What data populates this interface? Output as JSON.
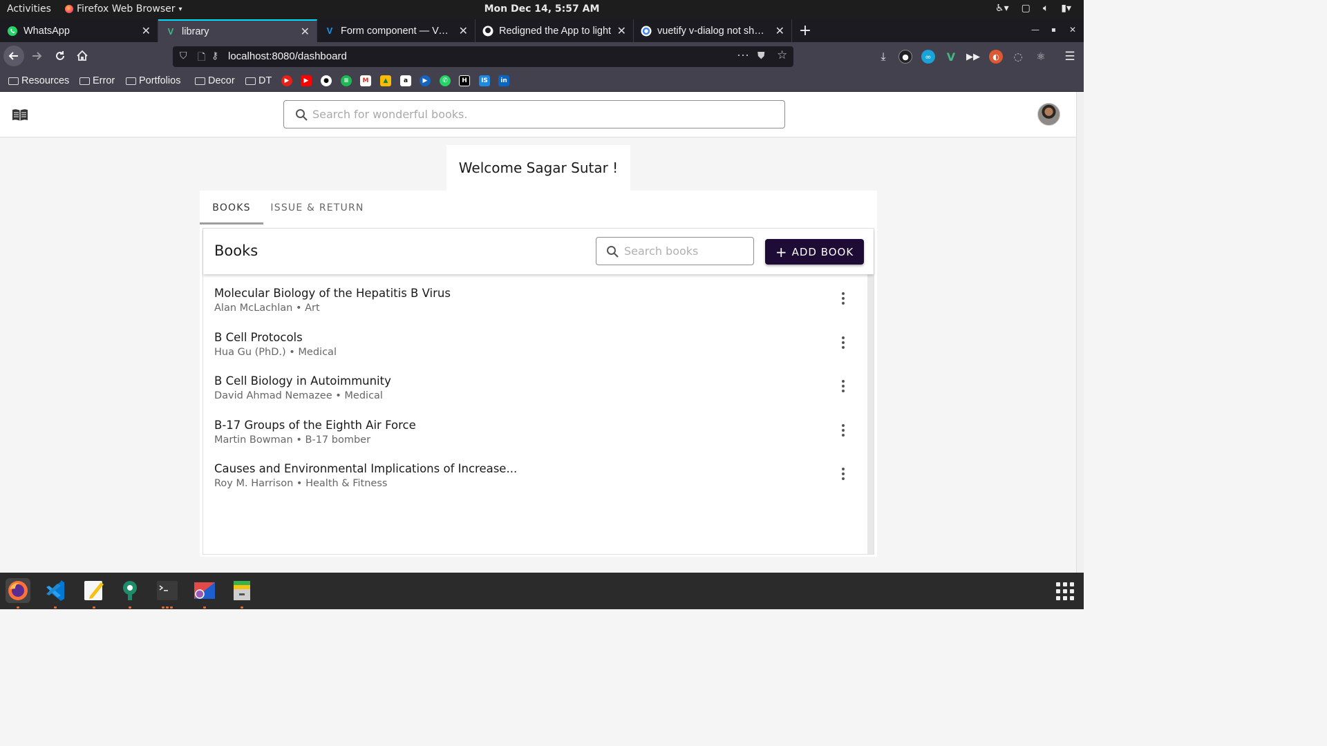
{
  "system": {
    "activities": "Activities",
    "app_name": "Firefox Web Browser",
    "clock": "Mon Dec 14,  5:57 AM"
  },
  "browser": {
    "tabs": [
      {
        "title": "WhatsApp",
        "icon": "whatsapp-icon"
      },
      {
        "title": "library",
        "icon": "vue-icon"
      },
      {
        "title": "Form component — Vuetify",
        "icon": "vuetify-icon"
      },
      {
        "title": "Redigned the App to light",
        "icon": "github-icon"
      },
      {
        "title": "vuetify v-dialog not showing",
        "icon": "google-icon"
      }
    ],
    "url": "localhost:8080/dashboard",
    "bookmarks": [
      {
        "label": "Resources"
      },
      {
        "label": "Error"
      },
      {
        "label": "Portfolios"
      },
      {
        "label": "Decor"
      },
      {
        "label": "DT"
      }
    ]
  },
  "app": {
    "search_placeholder": "Search for wonderful books.",
    "welcome": "Welcome Sagar Sutar !",
    "tabs": [
      {
        "label": "BOOKS"
      },
      {
        "label": "ISSUE & RETURN"
      }
    ],
    "books": {
      "title": "Books",
      "search_placeholder": "Search books",
      "add_label": "ADD BOOK",
      "items": [
        {
          "title": "Molecular Biology of the Hepatitis B Virus",
          "subtitle": "Alan McLachlan • Art"
        },
        {
          "title": "B Cell Protocols",
          "subtitle": "Hua Gu (PhD.) • Medical"
        },
        {
          "title": "B Cell Biology in Autoimmunity",
          "subtitle": "David Ahmad Nemazee • Medical"
        },
        {
          "title": "B-17 Groups of the Eighth Air Force",
          "subtitle": "Martin Bowman • B-17 bomber"
        },
        {
          "title": "Causes and Environmental Implications of Increase...",
          "subtitle": "Roy M. Harrison • Health & Fitness"
        }
      ]
    }
  },
  "colors": {
    "accent_button": "#1e0b36",
    "browser_chrome": "#42414d",
    "active_tab_line": "#00ddff"
  }
}
